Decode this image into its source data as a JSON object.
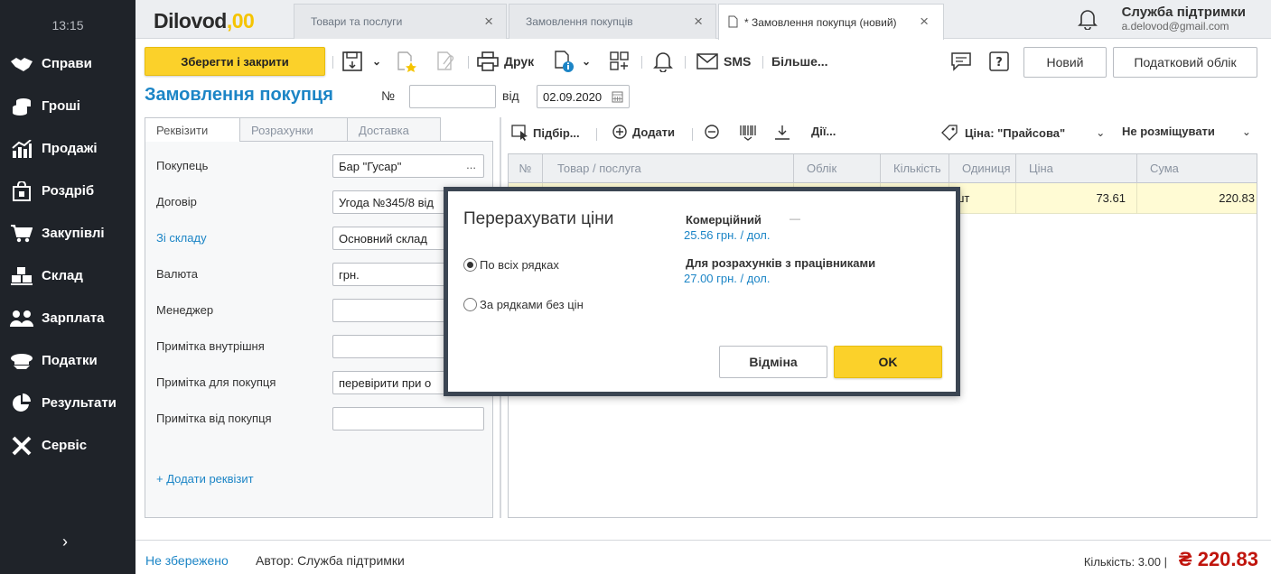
{
  "sidebar": {
    "time": "13:15",
    "items": [
      {
        "label": "Справи",
        "icon": "handshake-icon"
      },
      {
        "label": "Гроші",
        "icon": "coins-icon"
      },
      {
        "label": "Продажі",
        "icon": "chart-icon"
      },
      {
        "label": "Роздріб",
        "icon": "shopping-bag-icon"
      },
      {
        "label": "Закупівлі",
        "icon": "cart-icon"
      },
      {
        "label": "Склад",
        "icon": "boxes-icon"
      },
      {
        "label": "Зарплата",
        "icon": "people-icon"
      },
      {
        "label": "Податки",
        "icon": "officer-cap-icon"
      },
      {
        "label": "Результати",
        "icon": "pie-chart-icon"
      },
      {
        "label": "Сервіс",
        "icon": "tools-icon"
      }
    ],
    "expand_icon": "chevron-right-icon"
  },
  "header": {
    "logo_text": "Dilovod",
    "logo_suffix": ",00",
    "tabs": [
      {
        "label": "Товари та послуги",
        "active": false
      },
      {
        "label": "Замовлення покупців",
        "active": false
      },
      {
        "label": "* Замовлення покупця (новий)",
        "active": true
      }
    ],
    "support_name": "Служба підтримки",
    "support_email": "a.delovod@gmail.com"
  },
  "toolbar": {
    "save_close": "Зберегти і закрити",
    "print": "Друк",
    "sms": "SMS",
    "more": "Більше...",
    "new": "Новий",
    "tax": "Податковий облік"
  },
  "document": {
    "title": "Замовлення покупця",
    "number_label": "№",
    "number_value": "",
    "date_label": "від",
    "date_value": "02.09.2020"
  },
  "form": {
    "tabs": [
      "Реквізити",
      "Розрахунки",
      "Доставка"
    ],
    "fields": [
      {
        "label": "Покупець",
        "value": "Бар \"Гусар\"",
        "dots": true,
        "link": false
      },
      {
        "label": "Договір",
        "value": "Угода №345/8 від",
        "dots": false,
        "link": false
      },
      {
        "label": "Зі складу",
        "value": "Основний склад",
        "dots": false,
        "link": true
      },
      {
        "label": "Валюта",
        "value": "грн.",
        "dots": true,
        "link": false
      },
      {
        "label": "Менеджер",
        "value": "",
        "dots": false,
        "link": false
      },
      {
        "label": "Примітка внутрішня",
        "value": "",
        "dots": false,
        "link": false
      },
      {
        "label": "Примітка для покупця",
        "value": "перевірити при о",
        "dots": false,
        "link": false
      },
      {
        "label": "Примітка від покупця",
        "value": "",
        "dots": false,
        "link": false
      }
    ],
    "add_requisite": "+ Додати реквізит"
  },
  "goods": {
    "toolbar": {
      "pick": "Підбір...",
      "add": "Додати",
      "actions": "Дії...",
      "price": "Ціна: \"Прайсова\"",
      "placement": "Не розміщувати"
    },
    "columns": [
      "№",
      "Товар / послуга",
      "Облік",
      "Кількість",
      "Одиниця",
      "Ціна",
      "Сума"
    ],
    "rows": [
      {
        "num": "",
        "item": "",
        "account": "",
        "qty": "",
        "unit": "шт",
        "price": "73.61",
        "sum": "220.83"
      }
    ]
  },
  "modal": {
    "title": "Перерахувати ціни",
    "options": [
      {
        "label": "По всіх рядках",
        "checked": true
      },
      {
        "label": "За рядками без цін",
        "checked": false
      }
    ],
    "price_types": [
      {
        "name": "Комерційний",
        "value": "25.56 грн. / дол."
      },
      {
        "name": "Для розрахунків з працівниками",
        "value": "27.00 грн. / дол."
      }
    ],
    "cancel": "Відміна",
    "ok": "OK"
  },
  "footer": {
    "status": "Не збережено",
    "author": "Автор: Служба підтримки",
    "quantity": "Кількість: 3.00 |",
    "total": "₴ 220.83"
  },
  "colors": {
    "accent_yellow": "#fbd12a",
    "link_blue": "#1c85c6",
    "sidebar_bg": "#1f2329",
    "total_red": "#c0140c"
  }
}
